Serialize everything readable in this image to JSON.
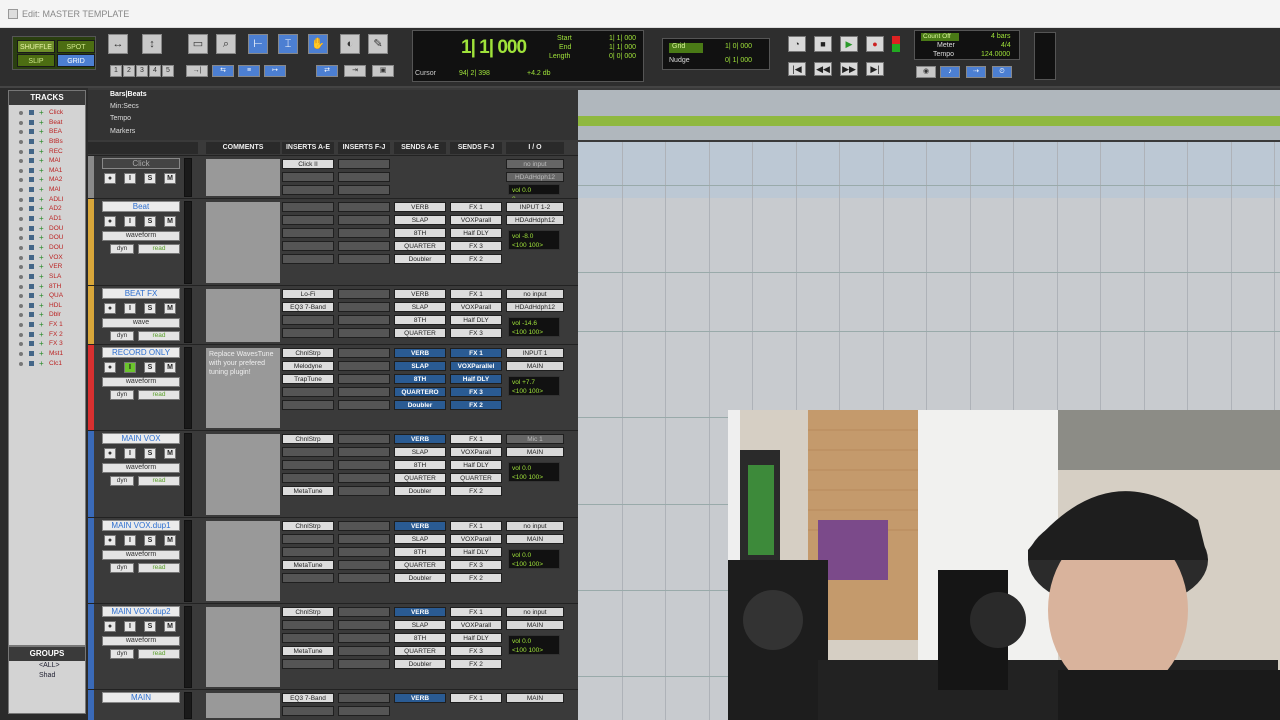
{
  "window": {
    "title": "Edit: MASTER TEMPLATE"
  },
  "toolbar": {
    "modes": [
      "SHUFFLE",
      "SPOT",
      "SLIP",
      "GRID"
    ],
    "zoom_presets": [
      "1",
      "2",
      "3",
      "4",
      "5"
    ],
    "tools": [
      "zoom-tool",
      "trim-tool",
      "selector-tool",
      "grabber-tool",
      "scrub-tool",
      "pencil-tool"
    ],
    "counter": {
      "main": "1| 1| 000",
      "start_label": "Start",
      "start_value": "1| 1| 000",
      "end_label": "End",
      "end_value": "1| 1| 000",
      "length_label": "Length",
      "length_value": "0| 0| 000",
      "cursor_label": "Cursor",
      "cursor_value": "94| 2| 398",
      "db_value": "+4.2 db"
    },
    "grid": {
      "label": "Grid",
      "value": "1| 0| 000"
    },
    "nudge": {
      "label": "Nudge",
      "value": "0| 1| 000"
    },
    "countoff": {
      "label": "Count Off",
      "bars": "4 bars",
      "meter_label": "Meter",
      "meter_value": "4/4",
      "tempo_label": "Tempo",
      "tempo_value": "124.0000"
    }
  },
  "tracks_panel": {
    "title": "TRACKS",
    "items": [
      "Click",
      "Beat",
      "BEA",
      "BtBs",
      "REC",
      "MAI",
      "MA1",
      "MA2",
      "MAI",
      "ADLI",
      "AD2",
      "AD1",
      "DOU",
      "DOU",
      "DOU",
      "VOX",
      "VER",
      "SLA",
      "8TH",
      "QUA",
      "HDL",
      "Dblr",
      "FX 1",
      "FX 2",
      "FX 3",
      "Mst1",
      "Clc1"
    ]
  },
  "groups_panel": {
    "title": "GROUPS",
    "items": [
      "<ALL>",
      "Shad"
    ]
  },
  "rulers": [
    "Bars|Beats",
    "Min:Secs",
    "Tempo",
    "Markers"
  ],
  "columns": [
    "COMMENTS",
    "INSERTS A-E",
    "INSERTS F-J",
    "SENDS A-E",
    "SENDS F-J",
    "I / O"
  ],
  "tracks": [
    {
      "name": "Click",
      "style": "inact",
      "vol": "",
      "pan": "",
      "comment": "",
      "inserts_ae": [
        "Click II"
      ],
      "inserts_fj": [],
      "sends_ae": [],
      "sends_fj": [],
      "io": [
        "no input",
        "HDAdHdph12"
      ],
      "io_vol": "0.0",
      "io_pan": "0"
    },
    {
      "name": "Beat",
      "style": "normal",
      "view": "waveform",
      "mode": "read",
      "comment": "",
      "inserts_ae": [],
      "inserts_fj": [],
      "sends_ae": [
        "VERB",
        "SLAP",
        "8TH",
        "QUARTER",
        "Doubler"
      ],
      "sends_fj": [
        "FX 1",
        "VOXParall",
        "Half DLY",
        "FX 3",
        "FX 2"
      ],
      "io": [
        "INPUT 1-2",
        "HDAdHdph12"
      ],
      "io_vol": "-8.0",
      "io_pan": "<100  100>"
    },
    {
      "name": "BEAT FX",
      "style": "normal",
      "view": "wave",
      "mode": "read",
      "comment": "",
      "inserts_ae": [
        "Lo-Fi",
        "EQ3 7-Band"
      ],
      "inserts_fj": [],
      "sends_ae": [
        "VERB",
        "SLAP",
        "8TH",
        "QUARTER"
      ],
      "sends_fj": [
        "FX 1",
        "VOXParall",
        "Half DLY",
        "FX 3"
      ],
      "io": [
        "no input",
        "HDAdHdph12"
      ],
      "io_vol": "-14.6",
      "io_pan": "<100  100>"
    },
    {
      "name": "RECORD ONLY",
      "style": "normal",
      "view": "waveform",
      "mode": "read",
      "comment": "Replace WavesTune with your prefered tuning plugin!",
      "inserts_ae": [
        "ChnlStrp",
        "Melodyne",
        "TrapTune"
      ],
      "inserts_fj": [],
      "sends_ae": [
        "VERB",
        "SLAP",
        "8TH",
        "QUARTERO",
        "Doubler"
      ],
      "sends_fj": [
        "FX 1",
        "VOXParallel",
        "Half DLY",
        "FX 3",
        "FX 2"
      ],
      "io": [
        "INPUT 1",
        "MAIN"
      ],
      "io_vol": "+7.7",
      "io_pan": "<100  100>"
    },
    {
      "name": "MAIN VOX",
      "style": "normal",
      "view": "waveform",
      "mode": "read",
      "comment": "",
      "inserts_ae": [
        "ChnlStrp",
        "",
        "",
        "",
        "MetaTune"
      ],
      "inserts_fj": [],
      "sends_ae": [
        "VERB",
        "SLAP",
        "8TH",
        "QUARTER",
        "Doubler"
      ],
      "sends_fj": [
        "FX 1",
        "VOXParall",
        "Half DLY",
        "QUARTER",
        "FX 2"
      ],
      "io": [
        "Mic 1",
        "MAIN"
      ],
      "io_vol": "0.0",
      "io_pan": "<100  100>"
    },
    {
      "name": "MAIN VOX.dup1",
      "style": "normal",
      "view": "waveform",
      "mode": "read",
      "comment": "",
      "inserts_ae": [
        "ChnlStrp",
        "",
        "",
        "MetaTune"
      ],
      "inserts_fj": [],
      "sends_ae": [
        "VERB",
        "SLAP",
        "8TH",
        "QUARTER",
        "Doubler"
      ],
      "sends_fj": [
        "FX 1",
        "VOXParall",
        "Half DLY",
        "FX 3",
        "FX 2"
      ],
      "io": [
        "no input",
        "MAIN"
      ],
      "io_vol": "0.0",
      "io_pan": "<100  100>"
    },
    {
      "name": "MAIN VOX.dup2",
      "style": "normal",
      "view": "waveform",
      "mode": "read",
      "comment": "",
      "inserts_ae": [
        "ChnlStrp",
        "",
        "",
        "MetaTune"
      ],
      "inserts_fj": [],
      "sends_ae": [
        "VERB",
        "SLAP",
        "8TH",
        "QUARTER",
        "Doubler"
      ],
      "sends_fj": [
        "FX 1",
        "VOXParall",
        "Half DLY",
        "FX 3",
        "FX 2"
      ],
      "io": [
        "no input",
        "MAIN"
      ],
      "io_vol": "0.0",
      "io_pan": "<100  100>"
    },
    {
      "name": "MAIN",
      "style": "normal",
      "view": "",
      "mode": "",
      "comment": "",
      "inserts_ae": [
        "EQ3 7-Band"
      ],
      "inserts_fj": [],
      "sends_ae": [
        "VERB"
      ],
      "sends_fj": [
        "FX 1"
      ],
      "io": [
        "MAIN"
      ],
      "io_vol": "",
      "io_pan": ""
    }
  ],
  "colors": {
    "accent": "#2d6fd0",
    "counter_green": "#9fe23a",
    "tempo_ruler": "#8fb83f"
  }
}
